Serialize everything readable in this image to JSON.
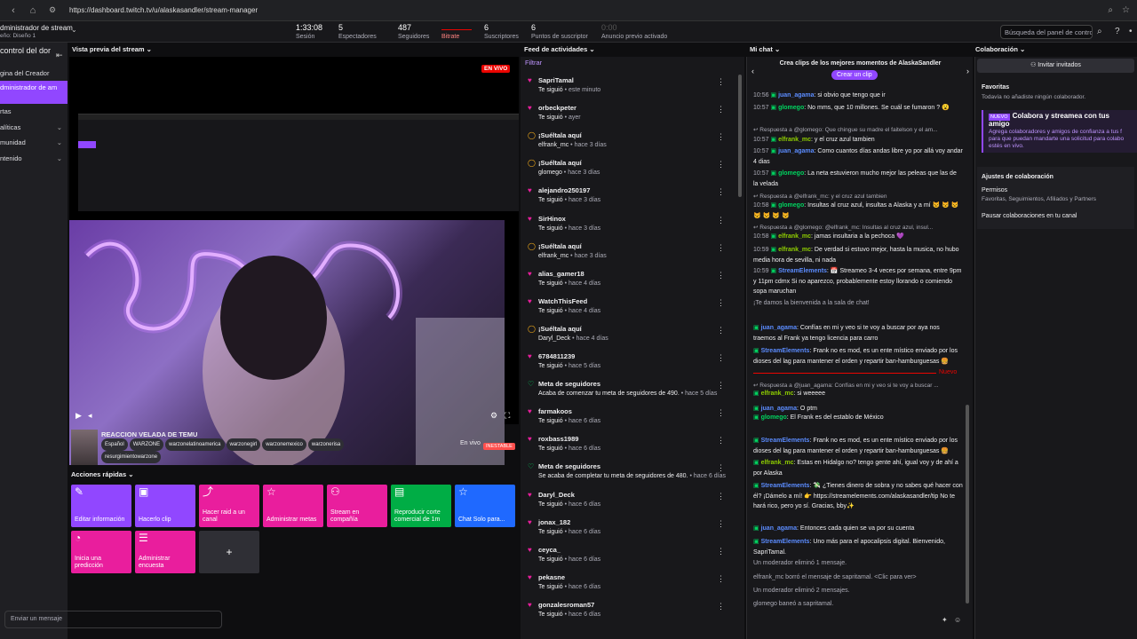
{
  "browser": {
    "url": "https://dashboard.twitch.tv/u/alaskasandler/stream-manager"
  },
  "topbar": {
    "title": "dministrador de stream",
    "subtitle": "eño: Diseño 1",
    "session": {
      "value": "1:33:08",
      "label": "Sesión"
    },
    "viewers": {
      "value": "5",
      "label": "Espectadores"
    },
    "followers": {
      "value": "487",
      "label": "Seguidores"
    },
    "bitrate": {
      "label": "Bitrate"
    },
    "subs": {
      "value": "6",
      "label": "Suscriptores"
    },
    "points": {
      "value": "6",
      "label": "Puntos de suscriptor"
    },
    "ad": {
      "value": "0:00",
      "label": "Anuncio previo activado"
    },
    "search_placeholder": "Búsqueda del panel de contro"
  },
  "sidebar": {
    "header": "control del dor",
    "items": [
      "gina del Creador",
      "dministrador de am",
      "rtas",
      "alíticas",
      "munidad",
      "ntenido"
    ]
  },
  "preview": {
    "header": "Vista previa del stream",
    "live": "EN VIVO"
  },
  "stream": {
    "title": "REACCION VELADA DE TEMU",
    "tags": [
      "Español",
      "WARZONE",
      "warzonelatinoamerica",
      "warzonegirl",
      "warzonemexico",
      "warzonerisa",
      "resurgimientowarzone"
    ],
    "status": "En vivo",
    "health": "INESTABLE"
  },
  "quick_actions": {
    "header": "Acciones rápidas",
    "items": [
      {
        "label": "Editar información",
        "icon": "pencil-icon",
        "color": "#9147ff"
      },
      {
        "label": "Hacerlo clip",
        "icon": "clip-icon",
        "color": "#9147ff"
      },
      {
        "label": "Hacer raid a un canal",
        "icon": "raid-icon",
        "color": "#e91e9d"
      },
      {
        "label": "Administrar metas",
        "icon": "star-icon",
        "color": "#e91e9d"
      },
      {
        "label": "Stream en compañía",
        "icon": "people-icon",
        "color": "#e91e9d"
      },
      {
        "label": "Reproducir corte comercial de 1m",
        "icon": "ad-icon",
        "color": "#00ad45"
      },
      {
        "label": "Chat Solo para...",
        "icon": "star-icon",
        "color": "#1f69ff"
      },
      {
        "label": "Inicia una predicción",
        "icon": "prediction-icon",
        "color": "#e91e9d"
      },
      {
        "label": "Administrar encuesta",
        "icon": "poll-icon",
        "color": "#e91e9d"
      },
      {
        "label": "+",
        "icon": "plus-icon",
        "color": "#2f2f35"
      }
    ]
  },
  "feed": {
    "header": "Feed de actividades",
    "filter": "Filtrar",
    "items": [
      {
        "icon": "heart",
        "name": "SapriTamal",
        "detail": "Te siguió",
        "time": " • este minuto"
      },
      {
        "icon": "heart",
        "name": "orbeckpeter",
        "detail": "Te siguió",
        "time": " • ayer"
      },
      {
        "icon": "shout",
        "name": "¡Suéltala aquí",
        "detail": "elfrank_mc",
        "time": " • hace 3 días"
      },
      {
        "icon": "shout",
        "name": "¡Suéltala aquí",
        "detail": "glomego",
        "time": " • hace 3 días"
      },
      {
        "icon": "heart",
        "name": "alejandro250197",
        "detail": "Te siguió",
        "time": " • hace 3 días"
      },
      {
        "icon": "heart",
        "name": "SirHinox",
        "detail": "Te siguió",
        "time": " • hace 3 días"
      },
      {
        "icon": "shout",
        "name": "¡Suéltala aquí",
        "detail": "elfrank_mc",
        "time": " • hace 3 días"
      },
      {
        "icon": "heart",
        "name": "alias_gamer18",
        "detail": "Te siguió",
        "time": " • hace 4 días"
      },
      {
        "icon": "heart",
        "name": "WatchThisFeed",
        "detail": "Te siguió",
        "time": " • hace 4 días"
      },
      {
        "icon": "shout",
        "name": "¡Suéltala aquí",
        "detail": "Daryl_Deck",
        "time": " • hace 4 días"
      },
      {
        "icon": "heart",
        "name": "6784811239",
        "detail": "Te siguió",
        "time": " • hace 5 días"
      },
      {
        "icon": "goal",
        "name": "Meta de seguidores",
        "detail": "Acaba de comenzar tu meta de seguidores de 490.",
        "time": " • hace 5 días"
      },
      {
        "icon": "heart",
        "name": "farmakoos",
        "detail": "Te siguió",
        "time": " • hace 6 días"
      },
      {
        "icon": "heart",
        "name": "roxbass1989",
        "detail": "Te siguió",
        "time": " • hace 6 días"
      },
      {
        "icon": "goal",
        "name": "Meta de seguidores",
        "detail": "Se acaba de completar tu meta de seguidores de 480.",
        "time": " • hace 6 días"
      },
      {
        "icon": "heart",
        "name": "Daryl_Deck",
        "detail": "Te siguió",
        "time": " • hace 6 días"
      },
      {
        "icon": "heart",
        "name": "jonax_182",
        "detail": "Te siguió",
        "time": " • hace 6 días"
      },
      {
        "icon": "heart",
        "name": "ceyca_",
        "detail": "Te siguió",
        "time": " • hace 6 días"
      },
      {
        "icon": "heart",
        "name": "pekasne",
        "detail": "Te siguió",
        "time": " • hace 6 días"
      },
      {
        "icon": "heart",
        "name": "gonzalesroman57",
        "detail": "Te siguió",
        "time": " • hace 6 días"
      }
    ]
  },
  "chat": {
    "header": "Mi chat",
    "clip_title": "Crea clips de los mejores momentos de AlaskaSandler",
    "clip_button": "Crear un clip",
    "new_label": "Nuevo",
    "input_placeholder": "Enviar un mensaje",
    "messages": [
      {
        "type": "msg",
        "ts": "10:56",
        "user": "juan_agama",
        "color": "#5b8cff",
        "text": ": si obvio que tengo que ir"
      },
      {
        "type": "msg",
        "ts": "10:57",
        "user": "glomego",
        "color": "#00d35f",
        "text": ": No mms, que 10 millones. Se cuál se fumaron ? 😮"
      },
      {
        "type": "reply",
        "text": "Respuesta a @glomego: Que chingue su madre el faitelson y el am..."
      },
      {
        "type": "msg",
        "ts": "10:57",
        "user": "elfrank_mc",
        "color": "#8fce00",
        "text": ": y el cruz azul tambien"
      },
      {
        "type": "msg",
        "ts": "10:57",
        "user": "juan_agama",
        "color": "#5b8cff",
        "text": ": Como cuantos días andas libre yo por allá voy andar 4 dias"
      },
      {
        "type": "msg",
        "ts": "10:57",
        "user": "glomego",
        "color": "#00d35f",
        "text": ": La neta estuvieron mucho mejor las peleas que las de la velada"
      },
      {
        "type": "reply",
        "text": "Respuesta a @elfrank_mc: y el cruz azul tambien"
      },
      {
        "type": "msg",
        "ts": "10:58",
        "user": "glomego",
        "color": "#00d35f",
        "text": ": Insultas al cruz azul, insultas a Alaska y a mí 😾 😾 😾 😾 😾 😾 😾"
      },
      {
        "type": "reply",
        "text": "Respuesta a @glomego: @elfrank_mc: Insultas al cruz azul, insul..."
      },
      {
        "type": "msg",
        "ts": "10:58",
        "user": "elfrank_mc",
        "color": "#8fce00",
        "text": ": jamas insultaria a la pechoca 💜"
      },
      {
        "type": "msg",
        "ts": "10:59",
        "user": "elfrank_mc",
        "color": "#8fce00",
        "text": ": De verdad si estuvo mejor, hasta la musica, no hubo media hora de sevilla, ni nada"
      },
      {
        "type": "msg",
        "ts": "10:59",
        "user": "StreamElements",
        "color": "#5b8cff",
        "text": ": 📅 Streameo 3-4 veces por semana, entre 9pm y 11pm cdmx Si no aparezco, probablemente estoy llorando o comiendo sopa maruchan"
      },
      {
        "type": "sys",
        "text": "¡Te damos la bienvenida a la sala de chat!"
      },
      {
        "type": "msg",
        "ts": "",
        "user": "juan_agama",
        "color": "#5b8cff",
        "text": ": Confías en mi y veo si te voy a buscar por aya nos traemos al Frank ya tengo licencia para carro"
      },
      {
        "type": "msg",
        "ts": "",
        "user": "StreamElements",
        "color": "#5b8cff",
        "text": ": Frank no es mod, es un ente místico enviado por los dioses del lag para mantener el orden y repartir ban-hamburguesas 🍔"
      },
      {
        "type": "reply",
        "text": "Respuesta a @juan_agama: Confías en mi y veo si te voy a buscar ..."
      },
      {
        "type": "msg",
        "ts": "",
        "user": "elfrank_mc",
        "color": "#8fce00",
        "text": ": si weeeee"
      },
      {
        "type": "msg",
        "ts": "",
        "user": "juan_agama",
        "color": "#5b8cff",
        "text": ": O ptm"
      },
      {
        "type": "msg",
        "ts": "",
        "user": "glomego",
        "color": "#00d35f",
        "text": ": El Frank es del establo de México"
      },
      {
        "type": "msg",
        "ts": "",
        "user": "StreamElements",
        "color": "#5b8cff",
        "text": ": Frank no es mod, es un ente místico enviado por los dioses del lag para mantener el orden y repartir ban-hamburguesas 🍔"
      },
      {
        "type": "msg",
        "ts": "",
        "user": "elfrank_mc",
        "color": "#8fce00",
        "text": ": Estas en Hidalgo no? tengo gente ahí, igual voy y de ahí a por Alaska"
      },
      {
        "type": "msg",
        "ts": "",
        "user": "StreamElements",
        "color": "#5b8cff",
        "text": ": 💸 ¿Tienes dinero de sobra y no sabes qué hacer con él? ¡Dámelo a mí! 👉 https://streamelements.com/alaskasandler/tip No te hará rico, pero yo sí. Gracias, bby✨"
      },
      {
        "type": "msg",
        "ts": "",
        "user": "juan_agama",
        "color": "#5b8cff",
        "text": ": Entonces cada quien se va por su cuenta"
      },
      {
        "type": "msg",
        "ts": "",
        "user": "StreamElements",
        "color": "#5b8cff",
        "text": ": Uno más para el apocalipsis digital. Bienvenido, SapriTamal."
      },
      {
        "type": "sys",
        "text": "Un moderador eliminó 1 mensaje."
      },
      {
        "type": "sys",
        "text": "elfrank_mc borró el mensaje de sapritamal. <Clic para ver>"
      },
      {
        "type": "sys",
        "text": "Un moderador eliminó 2 mensajes."
      },
      {
        "type": "sys",
        "text": "glomego baneó a sapritamal."
      }
    ]
  },
  "collab": {
    "header": "Colaboración",
    "invite": "Invitar invitados",
    "fav_title": "Favoritas",
    "fav_text": "Todavía no añadiste ningún colaborador.",
    "promo_badge": "NUEVO",
    "promo_title": "Colabora y streamea con tus amigo",
    "promo_text": "Agrega colaboradores y amigos de confianza a tus f para que puedan mandarte una solicitud para colabo estés en vivo.",
    "settings_title": "Ajustes de colaboración",
    "perm_title": "Permisos",
    "perm_text": "Favoritas, Seguimientos, Afiliados y Partners",
    "pause": "Pausar colaboraciones en tu canal"
  }
}
